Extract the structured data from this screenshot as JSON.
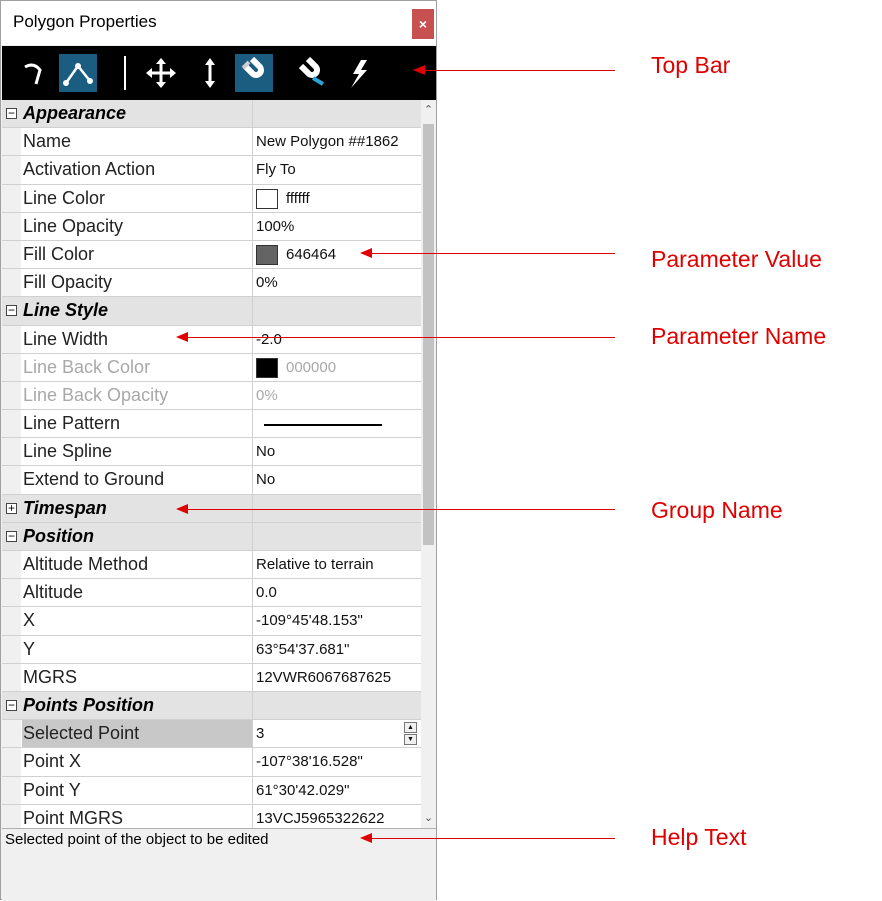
{
  "window": {
    "title": "Polygon Properties",
    "close_label": "×"
  },
  "toolbar": {
    "buttons": [
      {
        "icon": "curve-icon",
        "active": false
      },
      {
        "icon": "edit-points-icon",
        "active": true
      },
      {
        "icon": "move-icon",
        "active": false
      },
      {
        "icon": "vertical-move-icon",
        "active": false
      },
      {
        "icon": "snap-magnet-icon",
        "active": true
      },
      {
        "icon": "snap-magnet-off-icon",
        "active": false
      },
      {
        "icon": "pick-icon",
        "active": false
      }
    ]
  },
  "groups": [
    {
      "name": "Appearance",
      "expander": "−",
      "rows": [
        {
          "name": "Name",
          "value": "New Polygon ##1862"
        },
        {
          "name": "Activation Action",
          "value": "Fly To"
        },
        {
          "name": "Line Color",
          "value": "ffffff",
          "swatch": "#ffffff"
        },
        {
          "name": "Line Opacity",
          "value": "100%"
        },
        {
          "name": "Fill Color",
          "value": "646464",
          "swatch": "#646464"
        },
        {
          "name": "Fill Opacity",
          "value": "0%"
        }
      ]
    },
    {
      "name": "Line Style",
      "expander": "−",
      "rows": [
        {
          "name": "Line Width",
          "value": "-2.0"
        },
        {
          "name": "Line Back Color",
          "value": "000000",
          "swatch": "#000000",
          "disabled": true
        },
        {
          "name": "Line Back Opacity",
          "value": "0%",
          "disabled": true
        },
        {
          "name": "Line Pattern",
          "value": ""
        },
        {
          "name": "Line Spline",
          "value": "No"
        },
        {
          "name": "Extend to Ground",
          "value": "No"
        }
      ]
    },
    {
      "name": "Timespan",
      "expander": "+",
      "rows": []
    },
    {
      "name": "Position",
      "expander": "−",
      "rows": [
        {
          "name": "Altitude Method",
          "value": "Relative to terrain"
        },
        {
          "name": "Altitude",
          "value": "0.0"
        },
        {
          "name": "X",
          "value": "-109°45'48.153\""
        },
        {
          "name": "Y",
          "value": "63°54'37.681\""
        },
        {
          "name": "MGRS",
          "value": "12VWR6067687625"
        }
      ]
    },
    {
      "name": "Points Position",
      "expander": "−",
      "rows": [
        {
          "name": "Selected Point",
          "value": "3",
          "selected": true
        },
        {
          "name": "Point X",
          "value": "-107°38'16.528\""
        },
        {
          "name": "Point Y",
          "value": "61°30'42.029\""
        },
        {
          "name": "Point MGRS",
          "value": "13VCJ5965322622"
        }
      ]
    }
  ],
  "help_text": "Selected point of the object to be edited",
  "annotations": {
    "top_bar": "Top Bar",
    "parameter_value": "Parameter Value",
    "parameter_name": "Parameter Name",
    "group_name": "Group Name",
    "help_text": "Help Text"
  },
  "colors": {
    "annotation": "#e00000",
    "toolbar_bg": "#000000",
    "active_button": "#1a5d80",
    "close_button": "#c75050"
  }
}
